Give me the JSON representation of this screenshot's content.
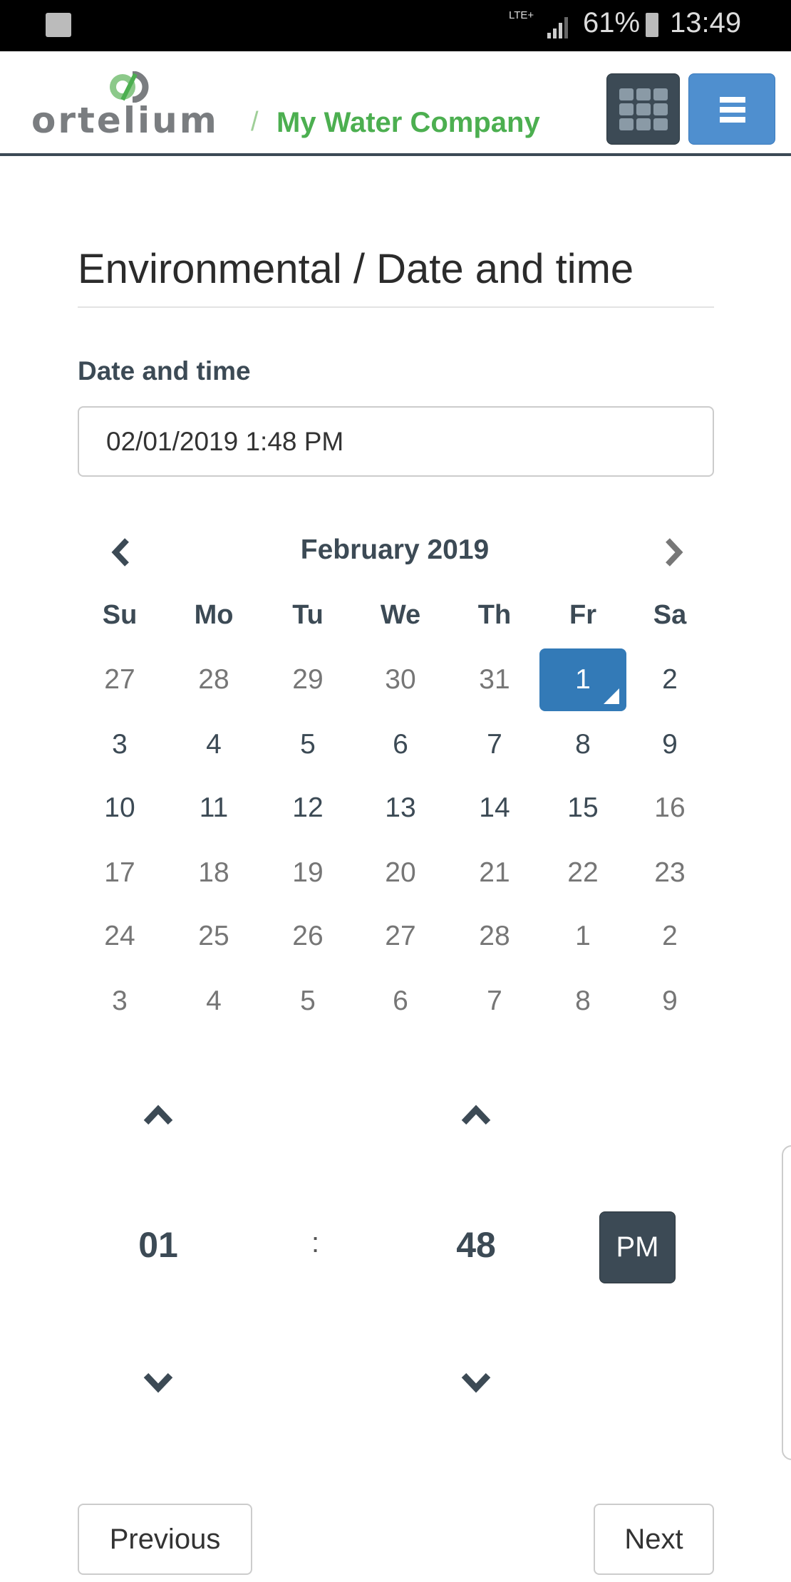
{
  "status_bar": {
    "network": "LTE+",
    "battery": "61%",
    "time": "13:49",
    "icons": [
      "wifi-icon",
      "signal-icon",
      "battery-charging-icon"
    ]
  },
  "header": {
    "logo_text": "ortelium",
    "separator": "/",
    "company": "My Water Company",
    "apps_button_icon": "grid-icon",
    "menu_button_icon": "hamburger-icon"
  },
  "page": {
    "title": "Environmental / Date and time"
  },
  "field": {
    "label": "Date and time",
    "value": "02/01/2019 1:48 PM"
  },
  "calendar": {
    "month_title": "February 2019",
    "weekdays": [
      "Su",
      "Mo",
      "Tu",
      "We",
      "Th",
      "Fr",
      "Sa"
    ],
    "weeks": [
      [
        {
          "d": "27",
          "s": "muted"
        },
        {
          "d": "28",
          "s": "muted"
        },
        {
          "d": "29",
          "s": "muted"
        },
        {
          "d": "30",
          "s": "muted"
        },
        {
          "d": "31",
          "s": "muted"
        },
        {
          "d": "1",
          "s": "sel"
        },
        {
          "d": "2",
          "s": "cur"
        }
      ],
      [
        {
          "d": "3",
          "s": "cur"
        },
        {
          "d": "4",
          "s": "cur"
        },
        {
          "d": "5",
          "s": "cur"
        },
        {
          "d": "6",
          "s": "cur"
        },
        {
          "d": "7",
          "s": "cur"
        },
        {
          "d": "8",
          "s": "cur"
        },
        {
          "d": "9",
          "s": "cur"
        }
      ],
      [
        {
          "d": "10",
          "s": "cur"
        },
        {
          "d": "11",
          "s": "cur"
        },
        {
          "d": "12",
          "s": "cur"
        },
        {
          "d": "13",
          "s": "cur"
        },
        {
          "d": "14",
          "s": "cur"
        },
        {
          "d": "15",
          "s": "cur"
        },
        {
          "d": "16",
          "s": "muted"
        }
      ],
      [
        {
          "d": "17",
          "s": "muted"
        },
        {
          "d": "18",
          "s": "muted"
        },
        {
          "d": "19",
          "s": "muted"
        },
        {
          "d": "20",
          "s": "muted"
        },
        {
          "d": "21",
          "s": "muted"
        },
        {
          "d": "22",
          "s": "muted"
        },
        {
          "d": "23",
          "s": "muted"
        }
      ],
      [
        {
          "d": "24",
          "s": "muted"
        },
        {
          "d": "25",
          "s": "muted"
        },
        {
          "d": "26",
          "s": "muted"
        },
        {
          "d": "27",
          "s": "muted"
        },
        {
          "d": "28",
          "s": "muted"
        },
        {
          "d": "1",
          "s": "muted"
        },
        {
          "d": "2",
          "s": "muted"
        }
      ],
      [
        {
          "d": "3",
          "s": "muted"
        },
        {
          "d": "4",
          "s": "muted"
        },
        {
          "d": "5",
          "s": "muted"
        },
        {
          "d": "6",
          "s": "muted"
        },
        {
          "d": "7",
          "s": "muted"
        },
        {
          "d": "8",
          "s": "muted"
        },
        {
          "d": "9",
          "s": "muted"
        }
      ]
    ],
    "selected_color": "#337ab7"
  },
  "time": {
    "hour": "01",
    "separator": ":",
    "minute": "48",
    "period": "PM"
  },
  "nav": {
    "previous": "Previous",
    "next": "Next"
  }
}
